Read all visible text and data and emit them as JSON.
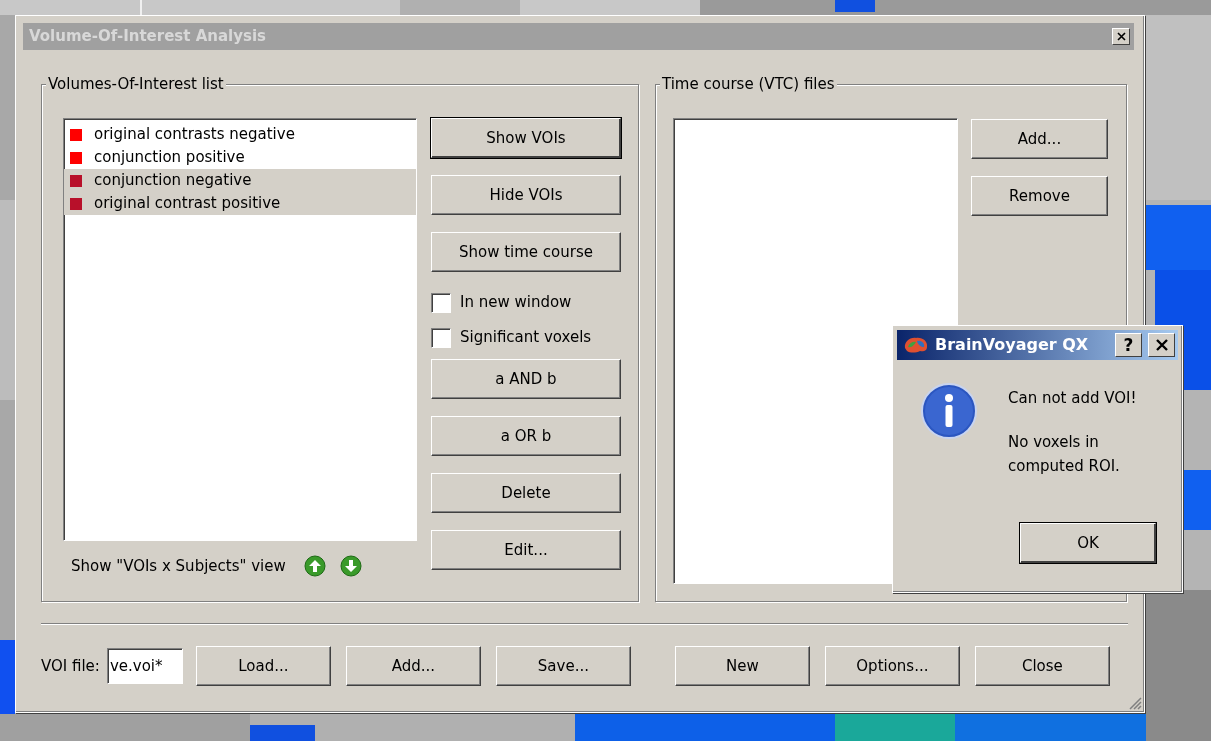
{
  "window": {
    "title": "Volume-Of-Interest Analysis"
  },
  "voi_group": {
    "title": "Volumes-Of-Interest list",
    "items": [
      {
        "label": "original contrasts negative",
        "color": "#ff0000",
        "selected": false
      },
      {
        "label": "conjunction positive",
        "color": "#ff0000",
        "selected": false
      },
      {
        "label": "conjunction negative",
        "color": "#b8102a",
        "selected": true
      },
      {
        "label": "original contrast positive",
        "color": "#b8102a",
        "selected": true
      }
    ],
    "view_label": "Show \"VOIs x Subjects\" view",
    "controls": [
      {
        "kind": "button",
        "label": "Show VOIs",
        "default": true
      },
      {
        "kind": "button",
        "label": "Hide VOIs",
        "default": false
      },
      {
        "kind": "button",
        "label": "Show time course",
        "default": false
      },
      {
        "kind": "checkbox",
        "label": "In new window",
        "checked": false
      },
      {
        "kind": "checkbox",
        "label": "Significant voxels",
        "checked": false
      },
      {
        "kind": "button",
        "label": "a AND b",
        "default": false
      },
      {
        "kind": "button",
        "label": "a OR b",
        "default": false
      },
      {
        "kind": "button",
        "label": "Delete",
        "default": false
      },
      {
        "kind": "button",
        "label": "Edit...",
        "default": false
      }
    ]
  },
  "vtc_group": {
    "title": "Time course (VTC) files",
    "buttons": [
      "Add...",
      "Remove"
    ]
  },
  "footer": {
    "file_label": "VOI file:",
    "file_value": "ve.voi*",
    "buttons": [
      "Load...",
      "Add...",
      "Save...",
      "New",
      "Options...",
      "Close"
    ]
  },
  "dialog": {
    "title": "BrainVoyager QX",
    "help": "?",
    "messages": [
      "Can not add VOI!",
      "No voxels in\ncomputed ROI."
    ],
    "button": "OK"
  }
}
